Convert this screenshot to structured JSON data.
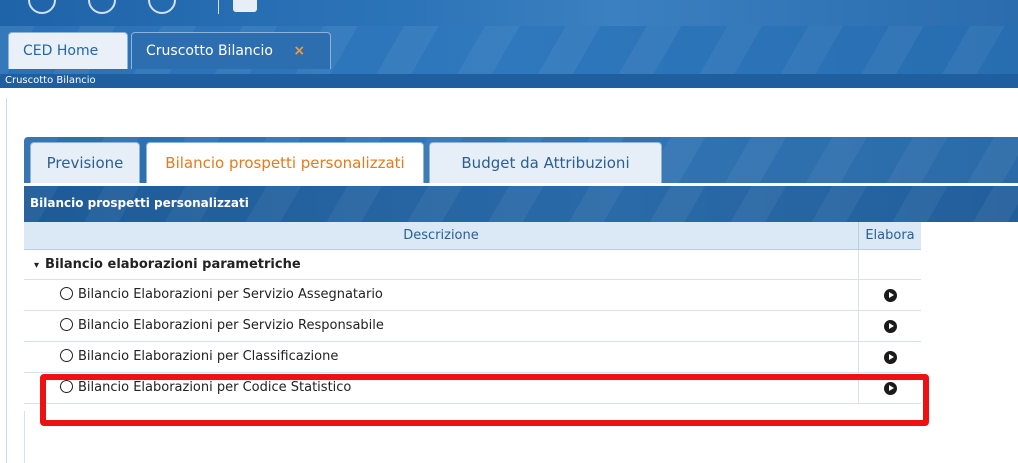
{
  "window": {
    "tabs": [
      {
        "label": "CED Home"
      },
      {
        "label": "Cruscotto Bilancio",
        "close": "×"
      }
    ],
    "breadcrumb": "Cruscotto Bilancio"
  },
  "panel": {
    "tabs": [
      {
        "label": "Previsione"
      },
      {
        "label": "Bilancio prospetti personalizzati"
      },
      {
        "label": "Budget da Attribuzioni"
      }
    ],
    "header": "Bilancio prospetti personalizzati"
  },
  "grid": {
    "columns": {
      "descrizione": "Descrizione",
      "elabora": "Elabora"
    },
    "group": {
      "expander": "▾",
      "label": "Bilancio elaborazioni parametriche"
    },
    "rows": [
      {
        "label": "Bilancio Elaborazioni per Servizio Assegnatario"
      },
      {
        "label": "Bilancio Elaborazioni per Servizio Responsabile"
      },
      {
        "label": "Bilancio Elaborazioni per Classificazione"
      },
      {
        "label": "Bilancio Elaborazioni per Codice Statistico"
      }
    ]
  },
  "icons": {
    "radio": "radio-icon",
    "run": "play-circle-icon",
    "close": "close-icon"
  },
  "colors": {
    "accent_orange": "#e27b1b",
    "header_blue": "#1e5a97",
    "highlight_red": "#ee1111"
  }
}
